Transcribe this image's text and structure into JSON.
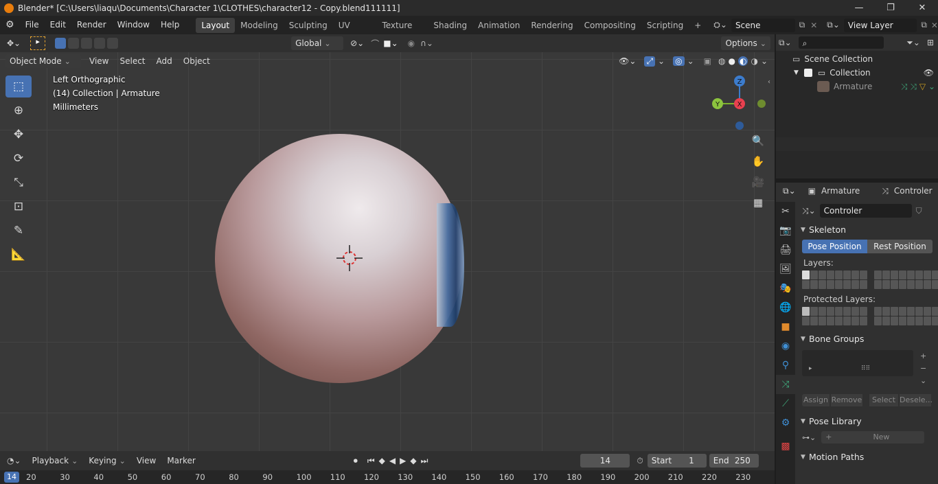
{
  "window": {
    "title": "Blender* [C:\\Users\\liaqu\\Documents\\Character 1\\CLOTHES\\character12 - Copy.blend111111]",
    "min": "—",
    "max": "❐",
    "close": "✕"
  },
  "menu": [
    "File",
    "Edit",
    "Render",
    "Window",
    "Help"
  ],
  "workspaces": [
    "Layout",
    "Modeling",
    "Sculpting",
    "UV Editing",
    "Texture Paint",
    "Shading",
    "Animation",
    "Rendering",
    "Compositing",
    "Scripting"
  ],
  "active_workspace": "Layout",
  "scene": "Scene",
  "view_layer": "View Layer",
  "tool_header": {
    "orientation": "Global",
    "options": "Options"
  },
  "viewport_header": {
    "mode": "Object Mode",
    "menus": [
      "View",
      "Select",
      "Add",
      "Object"
    ]
  },
  "overlay_text": {
    "view": "Left Orthographic",
    "collection": "(14) Collection | Armature",
    "units": "Millimeters"
  },
  "gizmo": {
    "z": "Z",
    "y": "Y",
    "x": "X"
  },
  "outliner": {
    "scene_collection": "Scene Collection",
    "collection": "Collection",
    "armature": "Armature"
  },
  "properties": {
    "breadcrumb_object": "Armature",
    "breadcrumb_data": "Controler",
    "data_name": "Controler",
    "skeleton": "Skeleton",
    "pose_position": "Pose Position",
    "rest_position": "Rest Position",
    "layers": "Layers:",
    "protected_layers": "Protected Layers:",
    "bone_groups": "Bone Groups",
    "assign": "Assign",
    "remove": "Remove",
    "select": "Select",
    "deselect": "Desele...",
    "pose_library": "Pose Library",
    "new": "New",
    "motion_paths": "Motion Paths"
  },
  "timeline": {
    "menus": [
      "Playback",
      "Keying",
      "View",
      "Marker"
    ],
    "current_frame": "14",
    "start_label": "Start",
    "start": "1",
    "end_label": "End",
    "end": "250",
    "ruler": [
      "20",
      "30",
      "40",
      "50",
      "60",
      "70",
      "80",
      "90",
      "100",
      "110",
      "120",
      "130",
      "140",
      "150",
      "160",
      "170",
      "180",
      "190",
      "200",
      "210",
      "220",
      "230"
    ],
    "playhead": "14"
  }
}
